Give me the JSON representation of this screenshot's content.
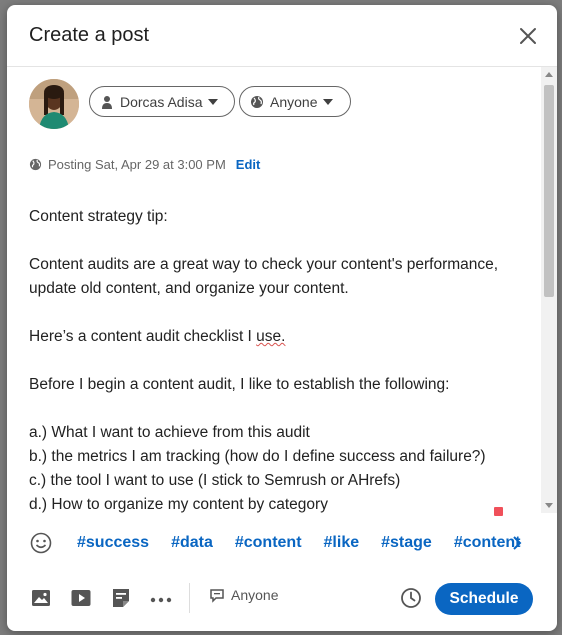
{
  "modal": {
    "title": "Create a post"
  },
  "author": {
    "name": "Dorcas Adisa"
  },
  "audience": {
    "label": "Anyone"
  },
  "schedule": {
    "text": "Posting Sat, Apr 29 at 3:00 PM",
    "edit_label": "Edit"
  },
  "post": {
    "lines": [
      "Content strategy tip:",
      "",
      "Content audits are a great way to check your content's performance,",
      "update old content, and organize your content.",
      "",
      "Here’s a content audit checklist I use.",
      "",
      "Before I begin a content audit, I like to establish the following:",
      "",
      "a.) What I want to achieve from this audit",
      "b.) the metrics I am tracking (how do I define success and failure?)",
      "c.) the tool I want to use (I stick to Semrush or AHrefs)",
      "d.) How to organize my content by category"
    ]
  },
  "hashtags": [
    "#success",
    "#data",
    "#content",
    "#like",
    "#stage",
    "#content"
  ],
  "footer": {
    "comment_audience": "Anyone",
    "schedule_button": "Schedule"
  },
  "colors": {
    "accent": "#0a66c2",
    "text": "#222222",
    "muted": "#666666"
  }
}
